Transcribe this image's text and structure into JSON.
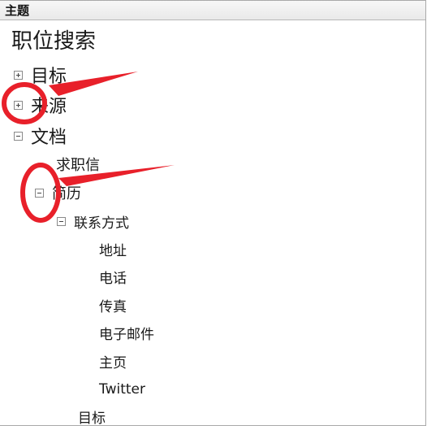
{
  "header": {
    "title": "主题"
  },
  "tree": {
    "root": "职位搜索",
    "level1": [
      {
        "label": "目标",
        "state": "collapsed"
      },
      {
        "label": "来源",
        "state": "collapsed"
      },
      {
        "label": "文档",
        "state": "expanded"
      }
    ],
    "doc_children": {
      "cover_letter": "求职信",
      "resume": "简历",
      "contact": "联系方式",
      "contact_items": [
        "地址",
        "电话",
        "传真",
        "电子邮件",
        "主页",
        "Twitter"
      ],
      "objective": "目标"
    }
  },
  "annotations": {
    "color": "#e8202a"
  }
}
